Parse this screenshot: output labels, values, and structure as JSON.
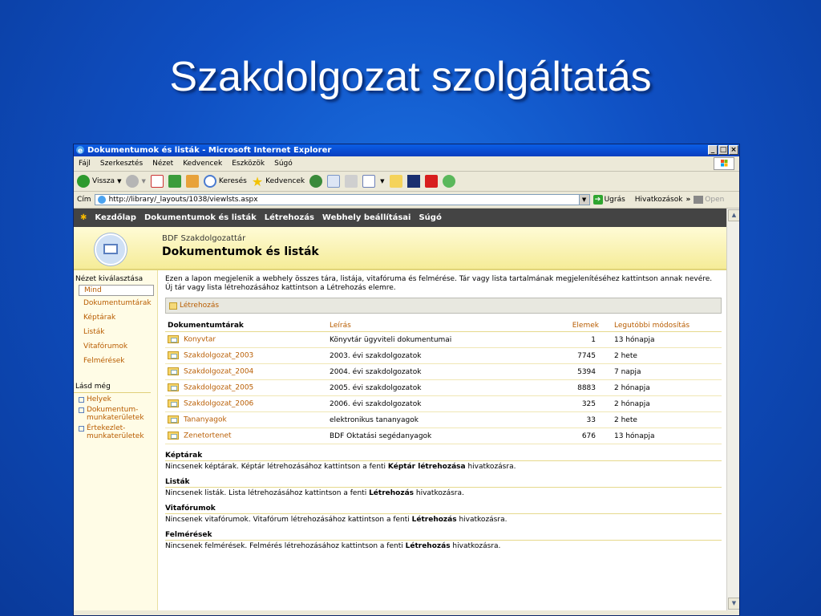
{
  "slide": {
    "title": "Szakdolgozat szolgáltatás"
  },
  "window": {
    "title": "Dokumentumok és listák - Microsoft Internet Explorer",
    "min": "_",
    "max": "□",
    "close": "×"
  },
  "menubar": [
    "Fájl",
    "Szerkesztés",
    "Nézet",
    "Kedvencek",
    "Eszközök",
    "Súgó"
  ],
  "toolbar": {
    "back": "Vissza",
    "search": "Keresés",
    "favorites": "Kedvencek"
  },
  "address": {
    "label": "Cím",
    "url": "http://library/_layouts/1038/viewlsts.aspx",
    "go": "Ugrás",
    "links": "Hivatkozások",
    "links_more": "»",
    "open": "Open"
  },
  "topnav": [
    "Kezdőlap",
    "Dokumentumok és listák",
    "Létrehozás",
    "Webhely beállításai",
    "Súgó"
  ],
  "banner": {
    "site": "BDF Szakdolgozattár",
    "page_title": "Dokumentumok és listák"
  },
  "leftnav": {
    "header": "Nézet kiválasztása",
    "selected": "Mind",
    "items": [
      "Dokumentumtárak",
      "Képtárak",
      "Listák",
      "Vitafórumok",
      "Felmérések"
    ],
    "see_also": "Lásd még",
    "links": [
      "Helyek",
      "Dokumentum-munkaterületek",
      "Értekezlet-munkaterületek"
    ]
  },
  "main": {
    "intro": "Ezen a lapon megjelenik a webhely összes tára, listája, vitafóruma és felmérése. Tár vagy lista tartalmának megjelenítéséhez kattintson annak nevére. Új tár vagy lista létrehozásához kattintson a Létrehozás elemre.",
    "create": "Létrehozás",
    "table": {
      "headers": [
        "Dokumentumtárak",
        "Leírás",
        "Elemek",
        "Legutóbbi módosítás"
      ],
      "rows": [
        {
          "name": "Konyvtar",
          "desc": "Könyvtár ügyviteli dokumentumai",
          "items": "1",
          "modified": "13 hónapja"
        },
        {
          "name": "Szakdolgozat_2003",
          "desc": "2003. évi szakdolgozatok",
          "items": "7745",
          "modified": "2 hete"
        },
        {
          "name": "Szakdolgozat_2004",
          "desc": "2004. évi szakdolgozatok",
          "items": "5394",
          "modified": "7 napja"
        },
        {
          "name": "Szakdolgozat_2005",
          "desc": "2005. évi szakdolgozatok",
          "items": "8883",
          "modified": "2 hónapja"
        },
        {
          "name": "Szakdolgozat_2006",
          "desc": "2006. évi szakdolgozatok",
          "items": "325",
          "modified": "2 hónapja"
        },
        {
          "name": "Tananyagok",
          "desc": "elektronikus tananyagok",
          "items": "33",
          "modified": "2 hete"
        },
        {
          "name": "Zenetortenet",
          "desc": "BDF Oktatási segédanyagok",
          "items": "676",
          "modified": "13 hónapja"
        }
      ]
    },
    "sections": [
      {
        "title": "Képtárak",
        "pre": "Nincsenek képtárak. Képtár létrehozásához kattintson a fenti ",
        "bold": "Képtár létrehozása",
        "post": " hivatkozásra."
      },
      {
        "title": "Listák",
        "pre": "Nincsenek listák. Lista létrehozásához kattintson a fenti ",
        "bold": "Létrehozás",
        "post": " hivatkozásra."
      },
      {
        "title": "Vitafórumok",
        "pre": "Nincsenek vitafórumok. Vitafórum létrehozásához kattintson a fenti ",
        "bold": "Létrehozás",
        "post": " hivatkozásra."
      },
      {
        "title": "Felmérések",
        "pre": "Nincsenek felmérések. Felmérés létrehozásához kattintson a fenti ",
        "bold": "Létrehozás",
        "post": " hivatkozásra."
      }
    ]
  }
}
